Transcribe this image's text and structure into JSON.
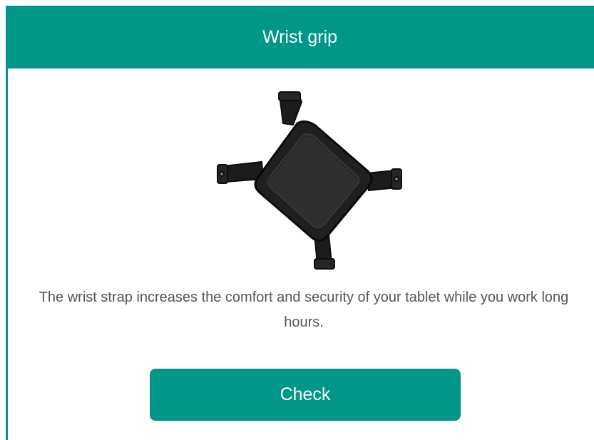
{
  "card": {
    "title": "Wrist grip",
    "description": "The wrist strap increases the comfort and security of your tablet while you work long hours.",
    "button_label": "Check",
    "image": "wrist-grip-product-image"
  },
  "colors": {
    "accent": "#009688",
    "text": "#555555",
    "background": "#ffffff"
  }
}
